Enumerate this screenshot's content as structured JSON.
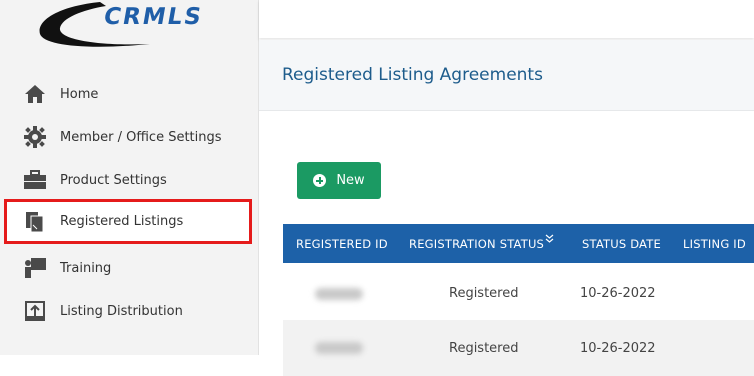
{
  "logo": {
    "text": "CRMLS"
  },
  "sidebar": {
    "items": [
      {
        "label": "Home",
        "icon": "home-icon"
      },
      {
        "label": "Member / Office Settings",
        "icon": "gear-icon"
      },
      {
        "label": "Product Settings",
        "icon": "toolbox-icon"
      },
      {
        "label": "Registered Listings",
        "icon": "documents-icon",
        "highlighted": true
      },
      {
        "label": "Training",
        "icon": "presenter-icon"
      },
      {
        "label": "Listing Distribution",
        "icon": "upload-icon"
      }
    ]
  },
  "page": {
    "title": "Registered Listing Agreements"
  },
  "toolbar": {
    "new_label": "New"
  },
  "table": {
    "columns": [
      "REGISTERED ID",
      "REGISTRATION STATUS",
      "STATUS DATE",
      "LISTING ID"
    ],
    "rows": [
      {
        "status": "Registered",
        "date": "10-26-2022"
      },
      {
        "status": "Registered",
        "date": "10-26-2022"
      }
    ]
  },
  "colors": {
    "accent": "#1d61a8",
    "new_button": "#1b9a63",
    "highlight_border": "#e51b1b",
    "title": "#1d5c8c"
  }
}
